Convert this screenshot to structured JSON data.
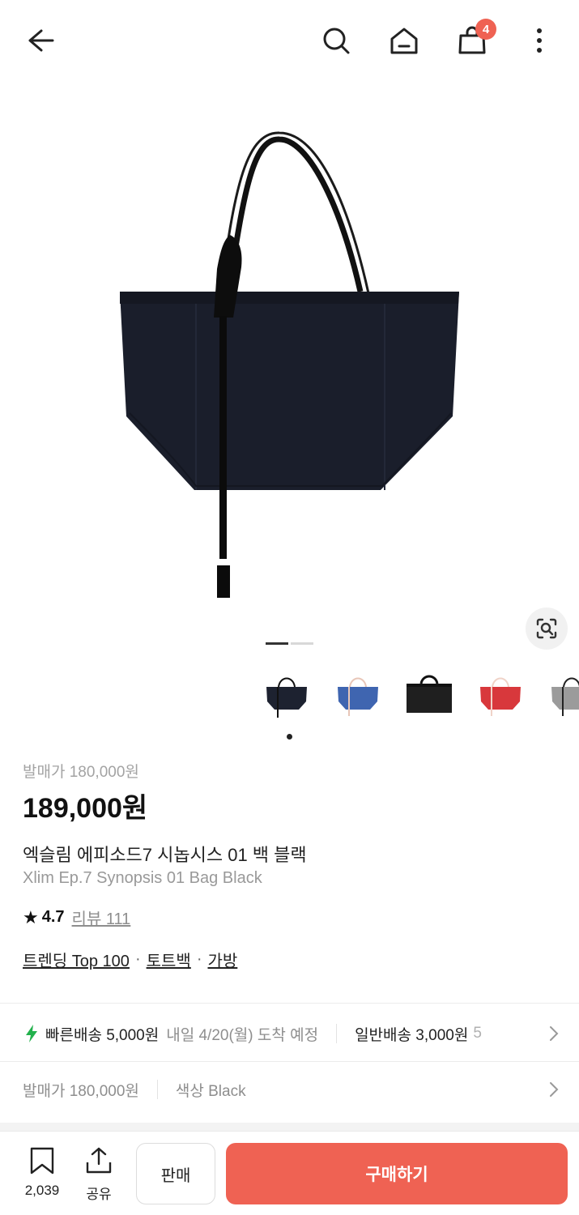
{
  "header": {
    "icons": [
      "back-arrow-icon",
      "search-icon",
      "home-icon",
      "shopping-bag-icon",
      "more-vertical-icon"
    ],
    "cart_count": "4"
  },
  "gallery": {
    "total_pages": 2,
    "current_page": 1,
    "thumbnails": [
      {
        "color_name": "black",
        "color": "#1d2230"
      },
      {
        "color_name": "blue",
        "color": "#3f65b0"
      },
      {
        "color_name": "charcoal",
        "color": "#1f1f1f"
      },
      {
        "color_name": "red",
        "color": "#d8383c"
      },
      {
        "color_name": "gray",
        "color": "#9b9b9b"
      }
    ]
  },
  "product": {
    "release_price": "발매가 180,000원",
    "price": "189,000원",
    "name_ko": "엑슬림 에피소드7 시놉시스 01 백 블랙",
    "name_en": "Xlim Ep.7 Synopsis 01 Bag Black",
    "rating": "4.7",
    "review_link": "리뷰 111",
    "tags": [
      "트렌딩 Top 100",
      "토트백",
      "가방"
    ]
  },
  "shipping": {
    "fast_label": "빠른배송 5,000원",
    "fast_eta": "내일 4/20(월) 도착 예정",
    "normal_label": "일반배송 3,000원",
    "normal_overflow": "5"
  },
  "options": {
    "release_price": "발매가 180,000원",
    "color": "색상 Black"
  },
  "bottom_bar": {
    "bookmark_count": "2,039",
    "share_label": "공유",
    "sell_label": "판매",
    "buy_label": "구매하기"
  },
  "colors": {
    "accent": "#ef6253",
    "bolt": "#22b14c"
  }
}
